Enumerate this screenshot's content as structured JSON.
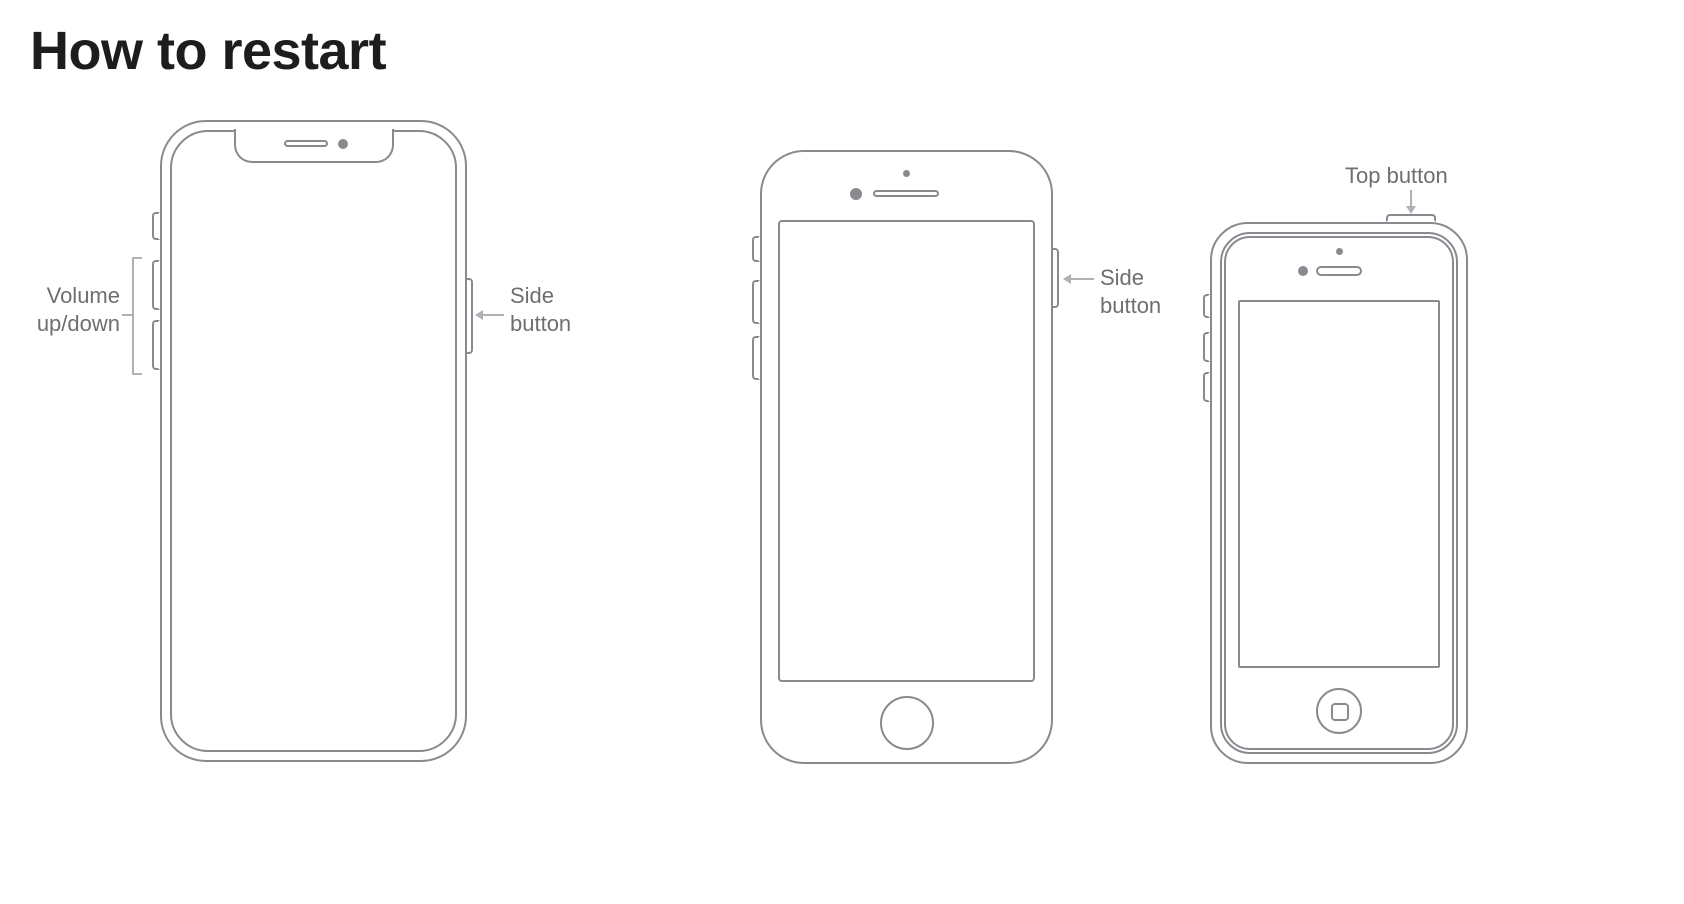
{
  "title": "How to restart",
  "labels": {
    "volume": "Volume\nup/down",
    "side1": "Side\nbutton",
    "side2": "Side\nbutton",
    "top": "Top button"
  },
  "phones": [
    {
      "model": "modern-notch",
      "buttons": [
        "volume-up",
        "volume-down",
        "side"
      ],
      "labeled": [
        "volume",
        "side"
      ]
    },
    {
      "model": "home-button",
      "buttons": [
        "volume-up",
        "volume-down",
        "mute",
        "side"
      ],
      "labeled": [
        "side"
      ]
    },
    {
      "model": "classic-se",
      "buttons": [
        "volume-up",
        "volume-down",
        "mute",
        "top"
      ],
      "labeled": [
        "top"
      ]
    }
  ]
}
